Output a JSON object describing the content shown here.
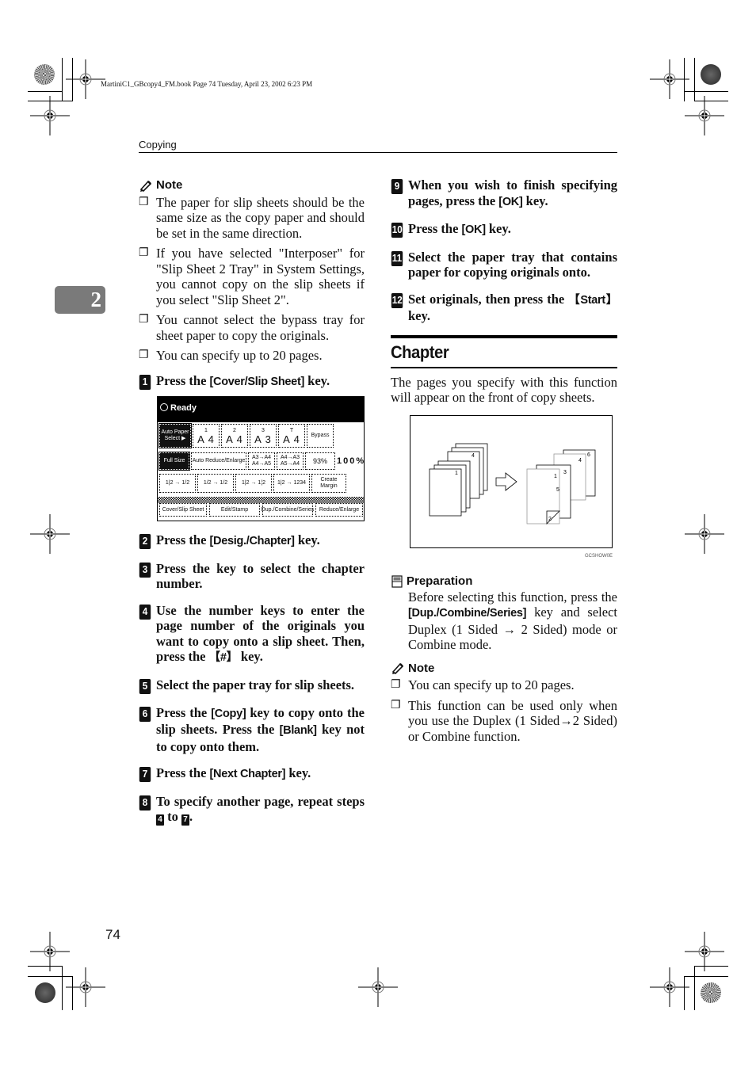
{
  "print_meta": "MartiniC1_GBcopy4_FM.book  Page 74  Tuesday, April 23, 2002  6:23 PM",
  "running_header": "Copying",
  "chapter_tab": "2",
  "page_number": "74",
  "left_column": {
    "note": {
      "title": "Note",
      "icon": "pencil-icon",
      "items": [
        "The paper for slip sheets should be the same size as the copy paper and should be set in the same direction.",
        "If you have selected \"Interposer\" for \"Slip Sheet 2 Tray\" in System Settings, you cannot copy on the slip sheets if you select \"Slip Sheet 2\".",
        "You cannot select the bypass tray for sheet paper to copy the originals.",
        "You can specify up to 20 pages."
      ]
    },
    "steps": [
      {
        "num": "1",
        "pre": "Press the ",
        "key": "[Cover/Slip Sheet]",
        "post": " key."
      },
      {
        "num": "2",
        "pre": "Press the ",
        "key": "[Desig./Chapter]",
        "post": " key."
      },
      {
        "num": "3",
        "pre": "Press the key to select the chapter number.",
        "key": "",
        "post": ""
      },
      {
        "num": "4",
        "pre": "Use the number keys to enter the page number of the originals you want to copy onto a slip sheet. Then, press the ",
        "key": "【#】",
        "post": " key."
      },
      {
        "num": "5",
        "pre": "Select the paper tray for slip sheets.",
        "key": "",
        "post": ""
      },
      {
        "num": "6",
        "pre": "Press the ",
        "key": "[Copy]",
        "mid": " key to copy onto the slip sheets. Press the ",
        "key2": "[Blank]",
        "post": " key not to copy onto them."
      },
      {
        "num": "7",
        "pre": "Press the ",
        "key": "[Next Chapter]",
        "post": " key."
      },
      {
        "num": "8",
        "pre": "To specify another page, repeat steps ",
        "ref1": "4",
        "mid": " to ",
        "ref2": "7",
        "post": "."
      }
    ],
    "panel": {
      "status": "Ready",
      "paper_select": "Auto Paper Select ▶",
      "trays": [
        {
          "label": "1",
          "size": "A 4"
        },
        {
          "label": "2",
          "size": "A 4"
        },
        {
          "label": "3",
          "size": "A 3"
        },
        {
          "label": "T",
          "size": "A 4"
        }
      ],
      "bypass": "Bypass",
      "full_size": "Full Size",
      "auto_reduce": "Auto Reduce/Enlarge",
      "ratio1": "A3→A4 A4→A5",
      "ratio2": "A4→A3 A5→A4",
      "ratio3": "93%",
      "zoom_value": "100%",
      "modes": [
        "1|2 → 1/2",
        "1/2 → 1/2",
        "1|2 → 1¦2",
        "1|2 → 1234"
      ],
      "create_margin": "Create Margin",
      "tabs": [
        "Cover/Slip Sheet",
        "Edit/Stamp",
        "Dup./Combine/Series",
        "Reduce/Enlarge"
      ]
    }
  },
  "right_column": {
    "steps": [
      {
        "num": "9",
        "pre": "When you wish to finish specifying pages, press the ",
        "key": "[OK]",
        "post": " key."
      },
      {
        "num": "10",
        "pre": "Press the ",
        "key": "[OK]",
        "post": " key."
      },
      {
        "num": "11",
        "pre": "Select the paper tray that contains paper for copying originals onto.",
        "key": "",
        "post": ""
      },
      {
        "num": "12",
        "pre": "Set originals, then press the ",
        "key": "【Start】",
        "post": " key."
      }
    ],
    "section_title": "Chapter",
    "intro": "The pages you specify with this function will appear on the front of copy sheets.",
    "figure": {
      "code": "GCSHOW0E",
      "left_stack_labels": [
        "1",
        "4"
      ],
      "right_stack_labels": [
        "1",
        "2",
        "3",
        "4",
        "5",
        "6"
      ]
    },
    "preparation": {
      "title": "Preparation",
      "pre": "Before selecting this function, press the ",
      "key": "[Dup./Combine/Series]",
      "post": " key and select Duplex (1 Sided → 2 Sided) mode or Combine mode."
    },
    "note": {
      "title": "Note",
      "items": [
        "You can specify up to 20 pages.",
        "This function can be used only when you use the Duplex (1 Sided→2 Sided) or Combine function."
      ]
    }
  }
}
